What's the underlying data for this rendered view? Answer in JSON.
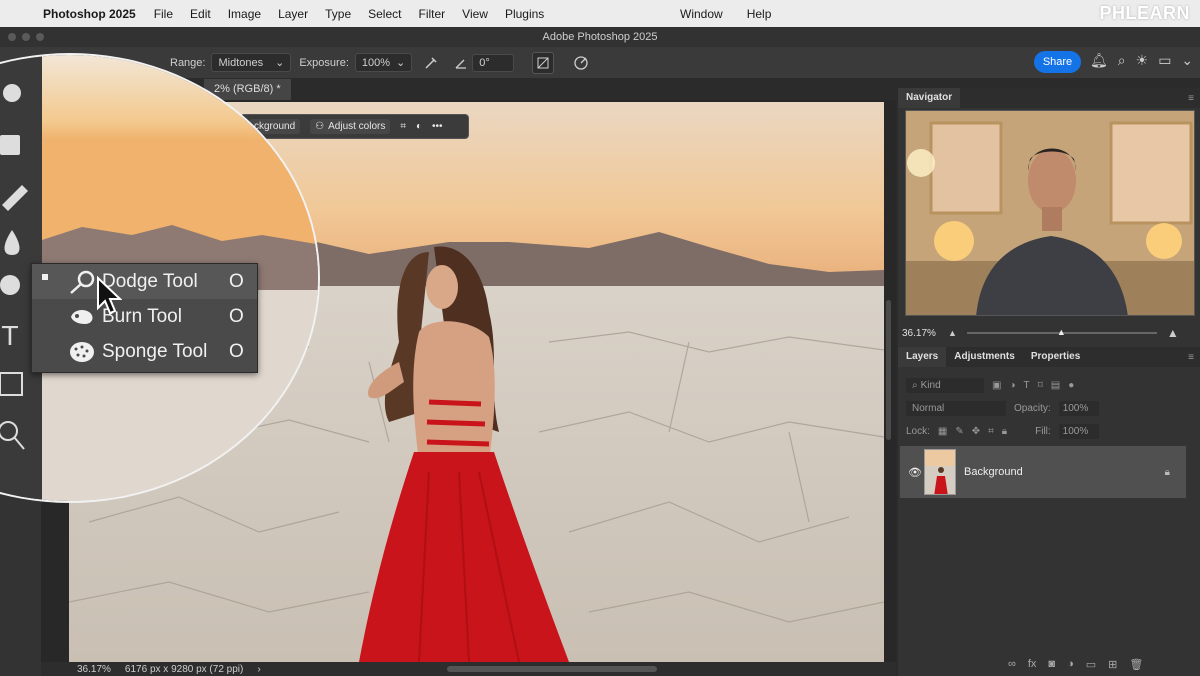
{
  "menubar": {
    "app_name": "Photoshop 2025",
    "items": [
      "File",
      "Edit",
      "Image",
      "Layer",
      "Type",
      "Select",
      "Filter",
      "View",
      "Plugins"
    ],
    "right_items": [
      "Window",
      "Help"
    ],
    "watermark": "PHLEARN"
  },
  "window": {
    "title": "Adobe Photoshop 2025"
  },
  "options_bar": {
    "range_label": "Range:",
    "range_value": "Midtones",
    "exposure_label": "Exposure:",
    "exposure_value": "100%",
    "angle_value": "0°",
    "share_label": "Share"
  },
  "document": {
    "tab_title": "2% (RGB/8) *"
  },
  "taskbar": {
    "background_label": "ckground",
    "adjust_colors_label": "Adjust colors"
  },
  "flyout": {
    "items": [
      {
        "label": "Dodge Tool",
        "shortcut": "O",
        "icon": "dodge-icon",
        "selected": true
      },
      {
        "label": "Burn Tool",
        "shortcut": "O",
        "icon": "burn-icon",
        "selected": false
      },
      {
        "label": "Sponge Tool",
        "shortcut": "O",
        "icon": "sponge-icon",
        "selected": false
      }
    ]
  },
  "status": {
    "zoom": "36.17%",
    "doc_info": "6176 px x 9280 px (72 ppi)"
  },
  "navigator": {
    "title": "Navigator",
    "zoom": "36.17%"
  },
  "layers_panel": {
    "tabs": [
      "Layers",
      "Adjustments",
      "Properties"
    ],
    "filter_label": "Kind",
    "blend_mode": "Normal",
    "opacity_label": "Opacity:",
    "opacity_value": "100%",
    "lock_label": "Lock:",
    "fill_label": "Fill:",
    "fill_value": "100%",
    "layers": [
      {
        "name": "Background",
        "visible": true,
        "locked": true
      }
    ]
  },
  "colors": {
    "accent": "#1473e6",
    "dress": "#c8141a"
  }
}
